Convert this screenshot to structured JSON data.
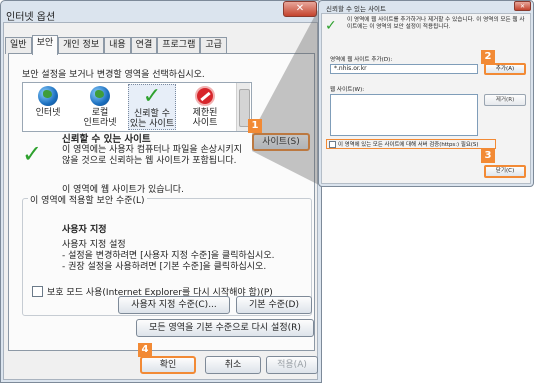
{
  "main_window": {
    "title": "인터넷 옵션",
    "close": "✕",
    "tabs": [
      "일반",
      "보안",
      "개인 정보",
      "내용",
      "연결",
      "프로그램",
      "고급"
    ],
    "active_tab": "보안",
    "zone_prompt": "보안 설정을 보거나 변경할 영역을 선택하십시오.",
    "zones": [
      {
        "label_1": "인터넷",
        "label_2": "",
        "icon": "globe-icon"
      },
      {
        "label_1": "로컬",
        "label_2": "인트라넷",
        "icon": "globe-icon"
      },
      {
        "label_1": "신뢰할 수",
        "label_2": "있는 사이트",
        "icon": "check-icon"
      },
      {
        "label_1": "제한된",
        "label_2": "사이트",
        "icon": "restricted-icon"
      }
    ],
    "selected_zone_heading": "신뢰할 수 있는 사이트",
    "selected_zone_desc": "이 영역에는 사용자 컴퓨터나 파일을 손상시키지 않을 것으로 신뢰하는 웹 사이트가 포함됩니다.",
    "zone_has_sites": "이 영역에 웹 사이트가 있습니다.",
    "sites_button": "사이트(S)",
    "security_level_group": "이 영역에 적용할 보안 수준(L)",
    "custom_heading": "사용자 지정",
    "custom_line_1": "사용자 지정 설정",
    "custom_line_2": "- 설정을 변경하려면 [사용자 지정 수준]을 클릭하십시오.",
    "custom_line_3": "- 권장 설정을 사용하려면 [기본 수준]을 클릭하십시오.",
    "protected_mode": "보호 모드 사용(Internet Explorer를 다시 시작해야 함)(P)",
    "custom_level_button": "사용자 지정 수준(C)...",
    "default_level_button": "기본 수준(D)",
    "reset_all_button": "모든 영역을 기본 수준으로 다시 설정(R)",
    "ok_button": "확인",
    "cancel_button": "취소",
    "apply_button": "적용(A)"
  },
  "trusted_dialog": {
    "title": "신뢰할 수 있는 사이트",
    "close": "✕",
    "intro": "이 영역에 웹 사이트를 추가하거나 제거할 수 있습니다. 이 영역의 모든 웹 사이트에는 이 영역의 보안 설정이 적용됩니다.",
    "add_label": "영역에 웹 사이트 추가(D):",
    "add_value": "*.nhis.or.kr",
    "add_button": "추가(A)",
    "sites_label": "웹 사이트(W):",
    "remove_button": "제거(R)",
    "https_checkbox": "이 영역에 있는 모든 사이트에 대해 서버 검증(https:) 필요(S)",
    "close_button": "닫기(C)"
  },
  "steps": [
    "1",
    "2",
    "3",
    "4"
  ],
  "colors": {
    "highlight": "#f28a35",
    "trusted_green": "#2ea12e",
    "window_frame": "#dbe4ee"
  }
}
